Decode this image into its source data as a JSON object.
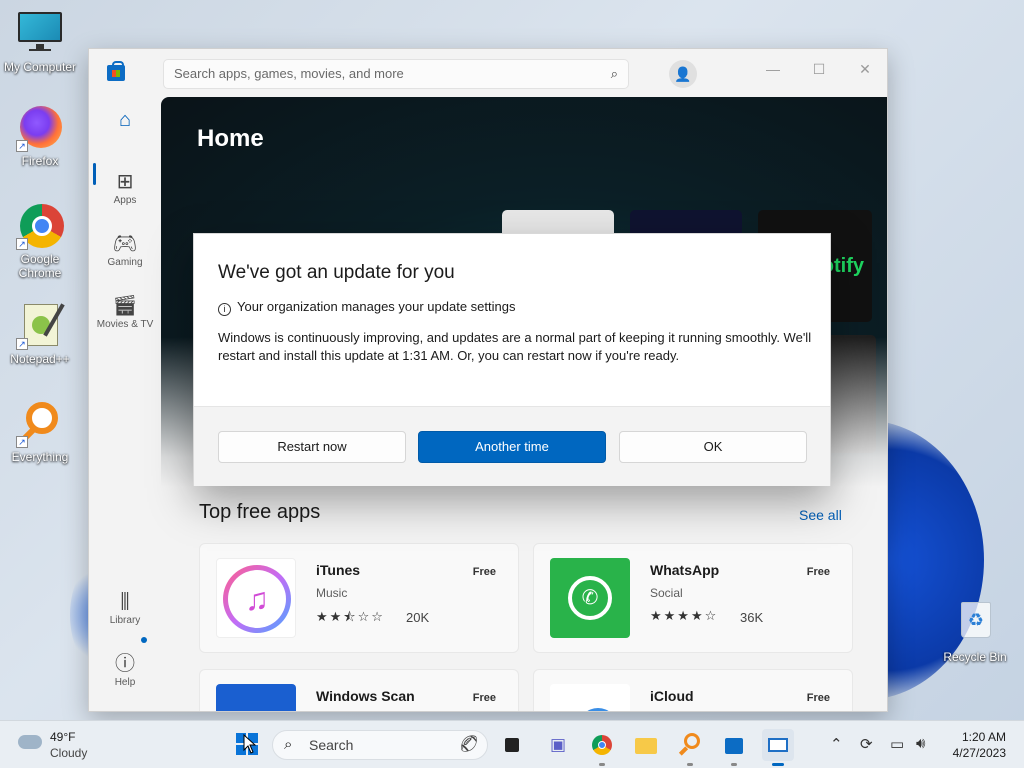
{
  "desktop": {
    "icons": [
      {
        "label": "My Computer",
        "icon": "monitor-icon"
      },
      {
        "label": "Firefox",
        "icon": "firefox-icon"
      },
      {
        "label": "Google Chrome",
        "icon": "chrome-icon"
      },
      {
        "label": "Notepad++",
        "icon": "notepad-plus-plus-icon"
      },
      {
        "label": "Everything",
        "icon": "everything-search-icon"
      },
      {
        "label": "Recycle Bin",
        "icon": "recycle-bin-icon"
      }
    ]
  },
  "store": {
    "search_placeholder": "Search apps, games, movies, and more",
    "nav": [
      {
        "label": "",
        "icon": "home-icon",
        "active": true
      },
      {
        "label": "Apps",
        "icon": "apps-icon"
      },
      {
        "label": "Gaming",
        "icon": "gamepad-icon"
      },
      {
        "label": "Movies & TV",
        "icon": "clapperboard-icon"
      },
      {
        "label": "Library",
        "icon": "library-icon"
      },
      {
        "label": "Help",
        "icon": "help-icon"
      }
    ],
    "hero": {
      "title": "Home",
      "tile_text": "otify"
    },
    "top_free": {
      "title": "Top free apps",
      "see_all": "See all",
      "apps": [
        {
          "name": "iTunes",
          "category": "Music",
          "price": "Free",
          "rating": 2.5,
          "count": "20K"
        },
        {
          "name": "WhatsApp",
          "category": "Social",
          "price": "Free",
          "rating": 4,
          "count": "36K"
        },
        {
          "name": "Windows Scan",
          "category": "",
          "price": "Free",
          "rating": null,
          "count": ""
        },
        {
          "name": "iCloud",
          "category": "",
          "price": "Free",
          "rating": null,
          "count": ""
        }
      ]
    }
  },
  "dialog": {
    "title": "We've got an update for you",
    "info": "Your organization manages your update settings",
    "body": "Windows is continuously improving, and updates are a normal part of keeping it running smoothly. We'll restart and install this update at 1:31 AM. Or, you can restart now if you're ready.",
    "buttons": {
      "restart": "Restart now",
      "another": "Another time",
      "ok": "OK"
    }
  },
  "taskbar": {
    "weather": {
      "temp": "49°F",
      "desc": "Cloudy"
    },
    "search_label": "Search",
    "clock": {
      "time": "1:20 AM",
      "date": "4/27/2023"
    }
  },
  "colors": {
    "accent": "#0067c0",
    "link": "#005fb8",
    "whatsapp": "#29b34a"
  }
}
